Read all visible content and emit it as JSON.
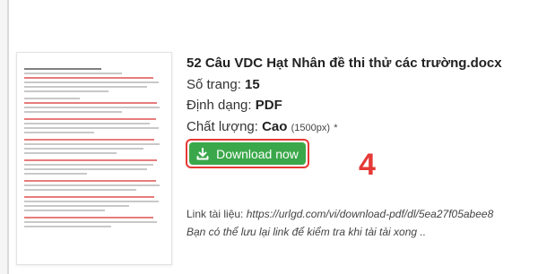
{
  "file": {
    "title": "52 Câu VDC Hạt Nhân đề thi thử các trường.docx",
    "pages_label": "Số trang:",
    "pages_value": "15",
    "format_label": "Định dạng:",
    "format_value": "PDF",
    "quality_label": "Chất lượng:",
    "quality_value": "Cao",
    "quality_detail": "(1500px)",
    "quality_mark": "*"
  },
  "download_button": {
    "label": "Download now",
    "icon": "download-icon",
    "color": "#3aa84a",
    "outline_color": "#e53935"
  },
  "annotation": {
    "step_number": "4",
    "color": "#e53935"
  },
  "link": {
    "label": "Link tài liệu:",
    "url": "https://urlgd.com/vi/download-pdf/dl/5ea27f05abee8"
  },
  "note": "Bạn có thể lưu lại link để kiểm tra khi tài tài xong .."
}
